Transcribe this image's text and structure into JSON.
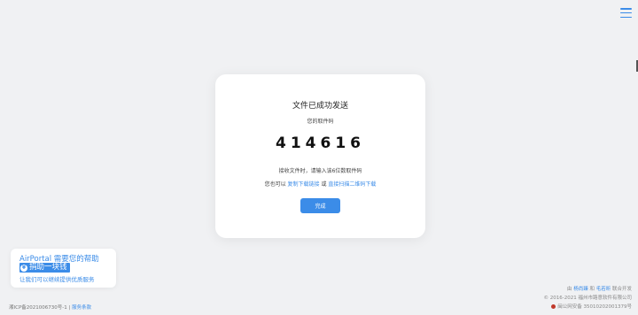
{
  "header": {
    "menu_icon": "hamburger-menu-icon",
    "accent": "#3b8ce8"
  },
  "card": {
    "title": "文件已成功发送",
    "subtitle": "您的取件码",
    "code": "414616",
    "hint": "接收文件时，请输入该6位数取件码",
    "links_prefix": "您也可以",
    "copy_link": "复制下载链接",
    "or": "或",
    "qr_link": "直接扫描二维码下载",
    "done_button": "完成"
  },
  "help": {
    "line1": "AirPortal 需要您的帮助",
    "donate": "捐助一块钱",
    "donate_icon": "yen-coin-icon",
    "line3": "让我们可以继续提供优质服务"
  },
  "footer": {
    "icp": "湘ICP备2021006730号-1",
    "separator": "|",
    "terms": "服务条款",
    "by": "由",
    "author1": "杨尚臻",
    "and": "和",
    "author2": "毛若昕",
    "joint": "联合开发",
    "copyright": "© 2016-2021 福州市路意软件有限公司",
    "police": "闽公网安备 35010202001379号",
    "police_icon": "police-badge-icon"
  }
}
